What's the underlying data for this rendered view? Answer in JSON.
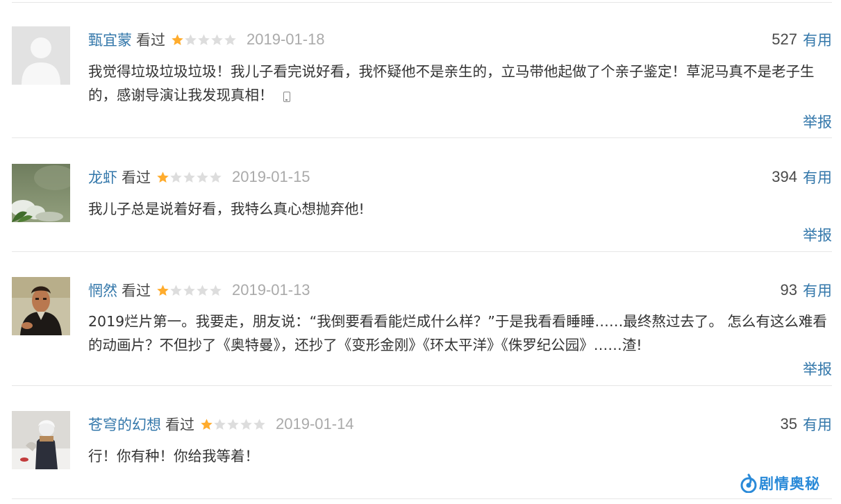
{
  "comments": [
    {
      "user": "甄宜蒙",
      "status": "看过",
      "rating": 1,
      "date": "2019-01-18",
      "votes": "527",
      "useful_label": "有用",
      "text": "我觉得垃圾垃圾垃圾！我儿子看完说好看，我怀疑他不是亲生的，立马带他起做了个亲子鉴定！草泥马真不是老子生的，感谢导演让我发现真相！",
      "report_label": "举报",
      "avatar_icon": "default-user-icon",
      "device_icon": "mobile-phone-icon"
    },
    {
      "user": "龙虾",
      "status": "看过",
      "rating": 1,
      "date": "2019-01-15",
      "votes": "394",
      "useful_label": "有用",
      "text": "我儿子总是说着好看，我特么真心想抛弃他!",
      "report_label": "举报",
      "avatar_icon": "plant-photo-avatar"
    },
    {
      "user": "惘然",
      "status": "看过",
      "rating": 1,
      "date": "2019-01-13",
      "votes": "93",
      "useful_label": "有用",
      "text": "2019烂片第一。我要走，朋友说：“我倒要看看能烂成什么样？”于是我看看睡睡……最终熬过去了。 怎么有这么难看的动画片？不但抄了《奥特曼》，还抄了《变形金刚》《环太平洋》《侏罗纪公园》……渣!",
      "report_label": "举报",
      "avatar_icon": "portrait-painting-avatar"
    },
    {
      "user": "苍穹的幻想",
      "status": "看过",
      "rating": 1,
      "date": "2019-01-14",
      "votes": "35",
      "useful_label": "有用",
      "text": "行！你有种！你给我等着！",
      "avatar_icon": "anime-figure-avatar"
    }
  ],
  "watermark": {
    "text": "剧情奥秘",
    "icon": "watermark-logo-icon"
  },
  "colors": {
    "link": "#3377aa",
    "star_on": "#ffac2d",
    "star_off": "#dddddd",
    "separator": "#e6e6e6"
  }
}
